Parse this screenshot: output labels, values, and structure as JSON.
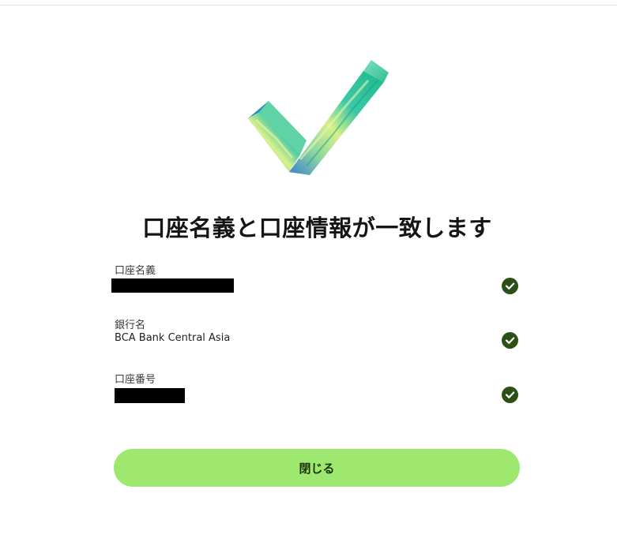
{
  "title": "口座名義と口座情報が一致します",
  "hero_icon": "checkmark-illustration-icon",
  "fields": [
    {
      "label": "口座名義",
      "value": "",
      "redacted": true,
      "status_icon": "check-circle-icon"
    },
    {
      "label": "銀行名",
      "value": "BCA Bank Central Asia",
      "redacted": false,
      "status_icon": "check-circle-icon"
    },
    {
      "label": "口座番号",
      "value": "",
      "redacted": true,
      "status_icon": "check-circle-icon"
    }
  ],
  "close_button": {
    "label": "閉じる"
  },
  "colors": {
    "accent_button": "#9fe870",
    "button_text": "#163300",
    "check_circle": "#2d5016",
    "redaction": "#000000"
  }
}
